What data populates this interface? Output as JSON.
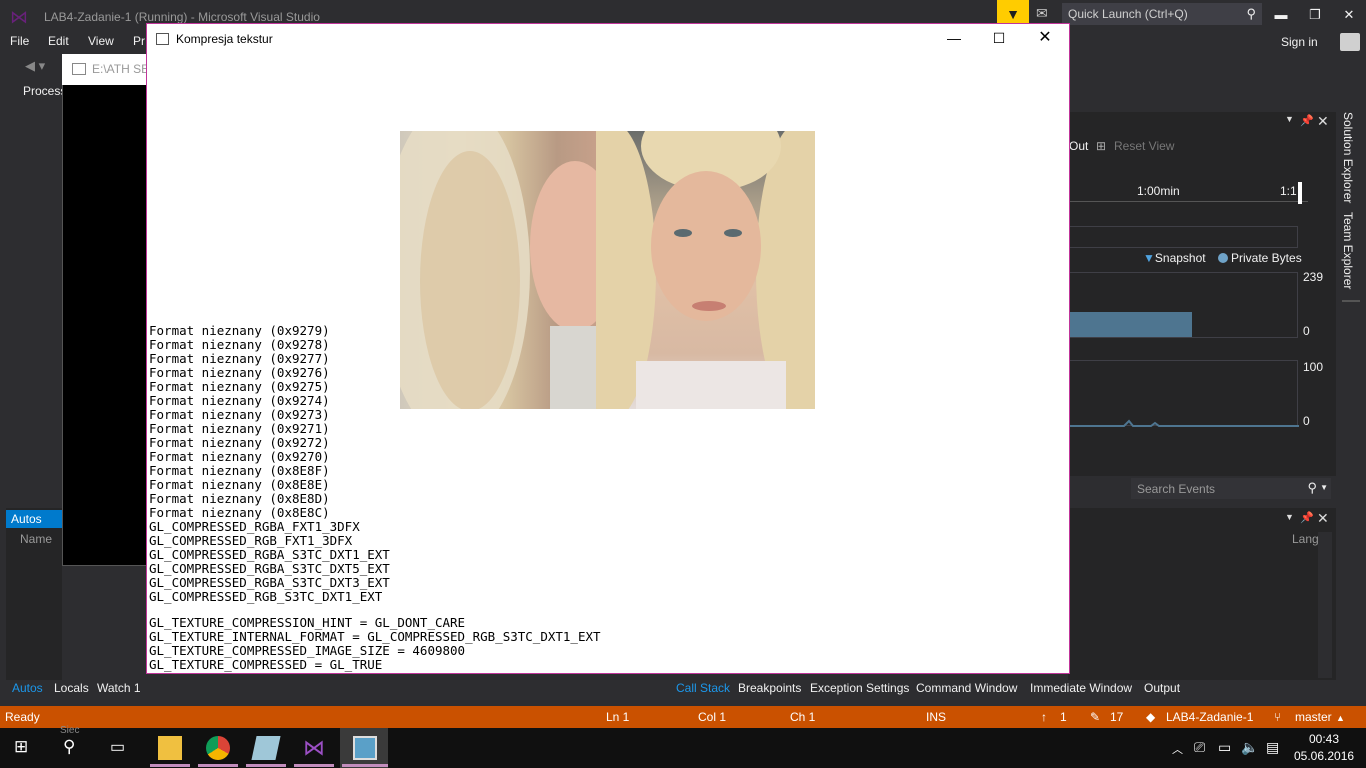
{
  "vs": {
    "title": "LAB4-Zadanie-1 (Running) - Microsoft Visual Studio",
    "quick_launch_placeholder": "Quick Launch (Ctrl+Q)",
    "menu": [
      "File",
      "Edit",
      "View",
      "Pr"
    ],
    "sign_in": "Sign in",
    "process_label": "Process"
  },
  "console": {
    "title": "E:\\ATH SE"
  },
  "diagnostics": {
    "zoom_out": "Out",
    "reset_view": "Reset View",
    "ticks": [
      "1:00min",
      "1:1"
    ],
    "legend_snapshot": "Snapshot",
    "legend_private_bytes": "Private Bytes",
    "memory_max": "239",
    "memory_min": "0",
    "cpu_max": "100",
    "cpu_min": "0",
    "search_events_placeholder": "Search Events",
    "memory_level_fraction": 0.54
  },
  "side_tabs": [
    "Solution Explorer",
    "Team Explorer"
  ],
  "lower_right": {
    "lang_col": "Lang"
  },
  "autos": {
    "tab": "Autos",
    "name_col": "Name"
  },
  "bottom_tabs_left": [
    "Autos",
    "Locals",
    "Watch 1"
  ],
  "bottom_tabs_right": [
    "Call Stack",
    "Breakpoints",
    "Exception Settings",
    "Command Window",
    "Immediate Window",
    "Output"
  ],
  "status": {
    "ready": "Ready",
    "ln": "Ln 1",
    "col": "Col 1",
    "ch": "Ch 1",
    "ins": "INS",
    "up_count": "1",
    "edit_count": "17",
    "project": "LAB4-Zadanie-1",
    "branch": "master"
  },
  "taskbar": {
    "time": "00:43",
    "date": "05.06.2016",
    "hidden_label": "Siec"
  },
  "app": {
    "title": "Kompresja tekstur",
    "format_lines": [
      "Format nieznany (0x9279)",
      "Format nieznany (0x9278)",
      "Format nieznany (0x9277)",
      "Format nieznany (0x9276)",
      "Format nieznany (0x9275)",
      "Format nieznany (0x9274)",
      "Format nieznany (0x9273)",
      "Format nieznany (0x9271)",
      "Format nieznany (0x9272)",
      "Format nieznany (0x9270)",
      "Format nieznany (0x8E8F)",
      "Format nieznany (0x8E8E)",
      "Format nieznany (0x8E8D)",
      "Format nieznany (0x8E8C)",
      "GL_COMPRESSED_RGBA_FXT1_3DFX",
      "GL_COMPRESSED_RGB_FXT1_3DFX",
      "GL_COMPRESSED_RGBA_S3TC_DXT1_EXT",
      "GL_COMPRESSED_RGBA_S3TC_DXT5_EXT",
      "GL_COMPRESSED_RGBA_S3TC_DXT3_EXT",
      "GL_COMPRESSED_RGB_S3TC_DXT1_EXT"
    ],
    "info_lines": [
      "GL_TEXTURE_COMPRESSION_HINT = GL_DONT_CARE",
      "GL_TEXTURE_INTERNAL_FORMAT = GL_COMPRESSED_RGB_S3TC_DXT1_EXT",
      "GL_TEXTURE_COMPRESSED_IMAGE_SIZE = 4609800",
      "GL_TEXTURE_COMPRESSED = GL_TRUE"
    ]
  }
}
